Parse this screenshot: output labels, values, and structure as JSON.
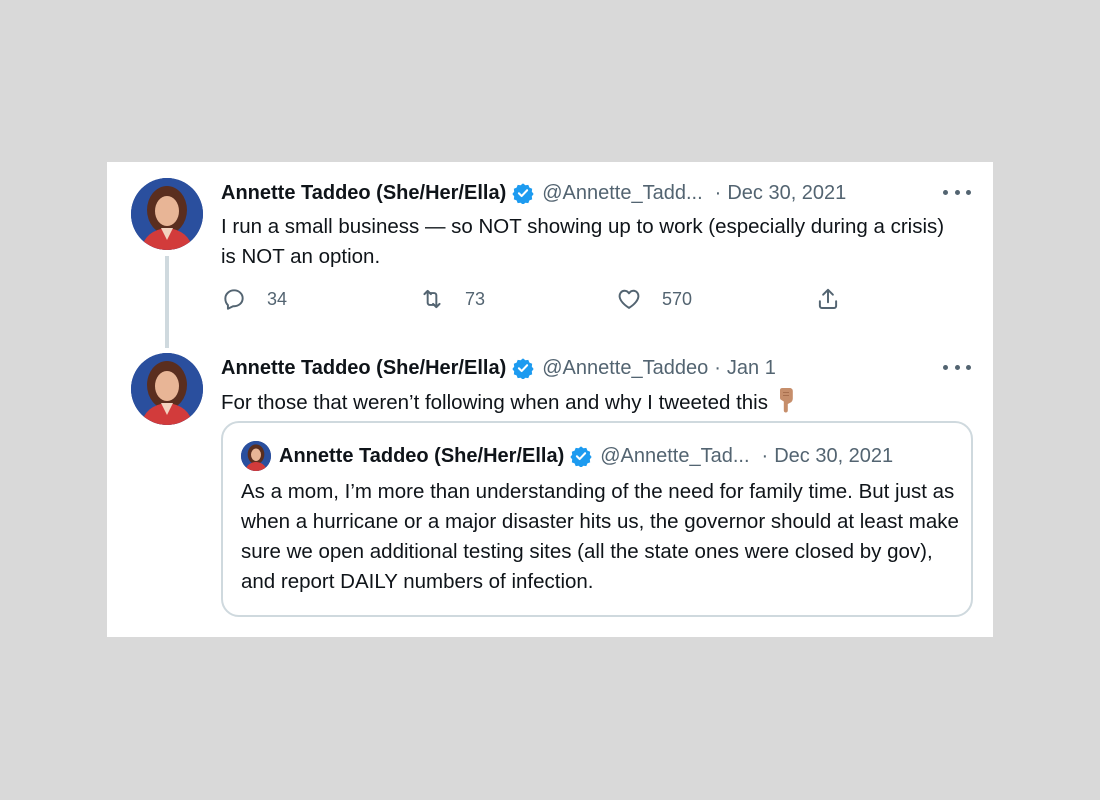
{
  "tweets": [
    {
      "author_name": "Annette Taddeo (She/Her/Ella)",
      "handle": "@Annette_Tadd...",
      "separator": "·",
      "date": "Dec 30, 2021",
      "text": "I run a small business — so NOT showing up to work (especially during a crisis) is NOT an option.",
      "stats": {
        "replies": "34",
        "retweets": "73",
        "likes": "570"
      }
    },
    {
      "author_name": "Annette Taddeo (She/Her/Ella)",
      "handle": "@Annette_Taddeo",
      "separator": "·",
      "date": "Jan 1",
      "text": "For those that weren’t following when and why I tweeted this"
    }
  ],
  "quoted": {
    "author_name": "Annette Taddeo (She/Her/Ella)",
    "handle": "@Annette_Tad...",
    "separator": "·",
    "date": "Dec 30, 2021",
    "text": "As a mom, I’m more than understanding of the need for family time. But just as when a hurricane or a major disaster hits us, the governor should at least make sure we open additional testing sites (all the state ones were closed by gov), and report  DAILY numbers of infection."
  },
  "icons": {
    "verified": "verified-badge-icon",
    "reply": "reply-icon",
    "retweet": "retweet-icon",
    "like": "heart-icon",
    "share": "share-icon",
    "more": "more-icon",
    "emoji": "backhand-index-pointing-down-icon"
  },
  "colors": {
    "background": "#d9d9d9",
    "card": "#ffffff",
    "text": "#0f1419",
    "secondary": "#536471",
    "verified": "#1d9bf0",
    "border": "#cfd9de"
  }
}
